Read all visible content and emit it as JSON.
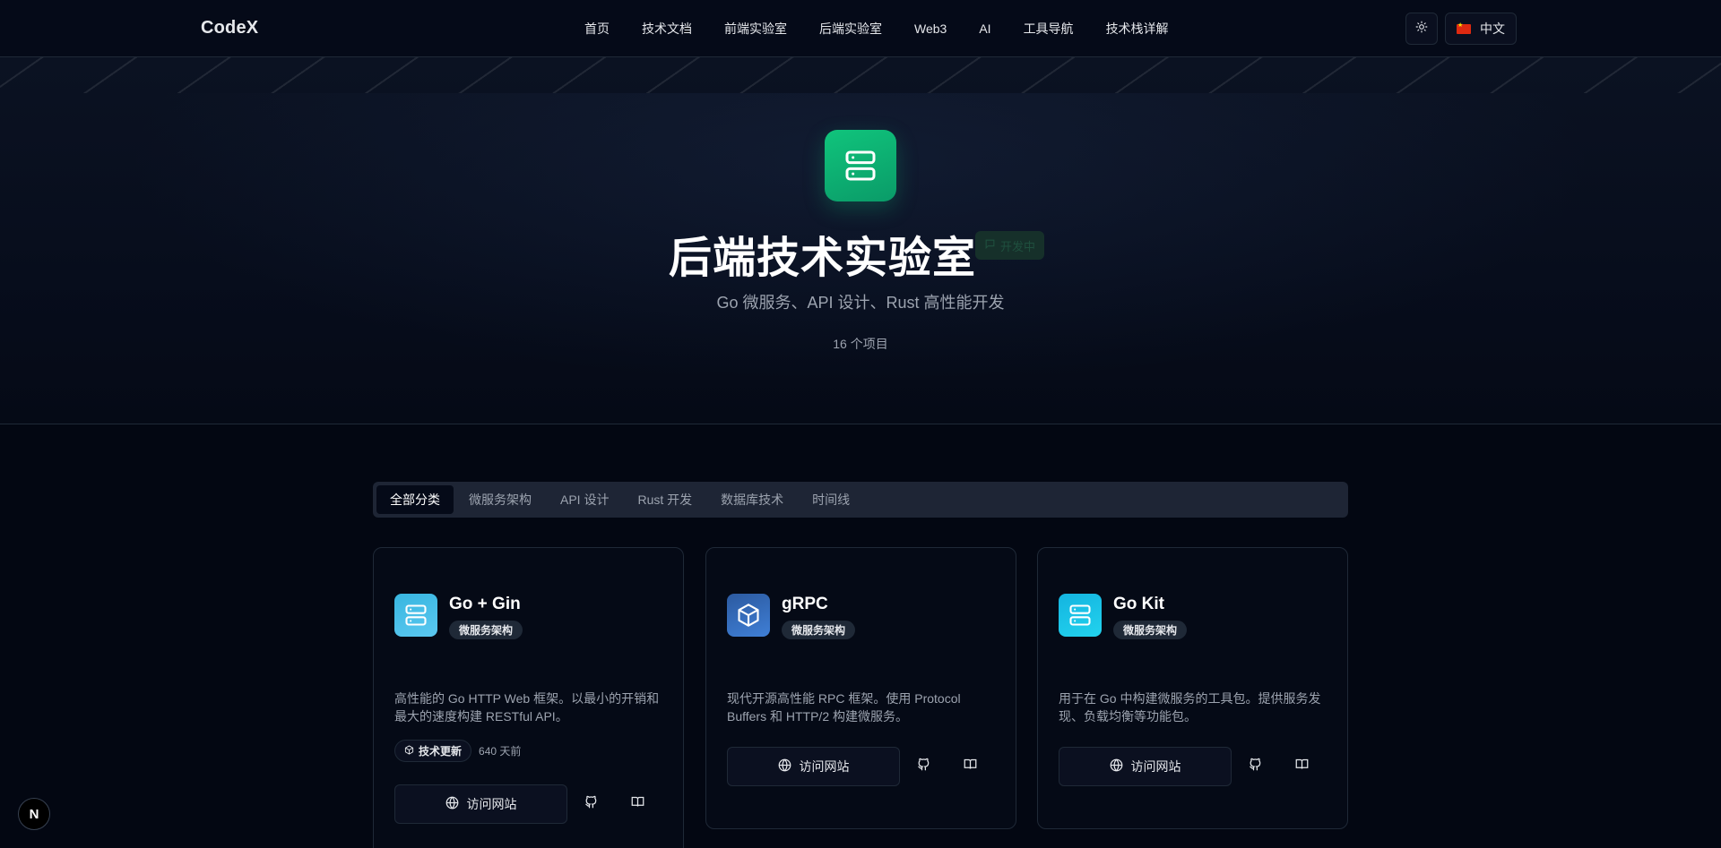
{
  "nav": {
    "logo": "CodeX",
    "links": [
      "首页",
      "技术文档",
      "前端实验室",
      "后端实验室",
      "Web3",
      "AI",
      "工具导航",
      "技术栈详解"
    ],
    "theme_icon": "sun-icon",
    "language": "中文"
  },
  "hero": {
    "icon": "server-icon",
    "title": "后端技术实验室",
    "badge": "开发中",
    "subtitle": "Go 微服务、API 设计、Rust 高性能开发",
    "count": "16 个项目"
  },
  "tabs": {
    "items": [
      "全部分类",
      "微服务架构",
      "API 设计",
      "Rust 开发",
      "数据库技术",
      "时间线"
    ],
    "active_index": 0
  },
  "cards": [
    {
      "icon": "server-icon",
      "icon_gradient": [
        "#38b6e0",
        "#5bc8f0"
      ],
      "title": "Go + Gin",
      "tag": "微服务架构",
      "desc": "高性能的 Go HTTP Web 框架。以最小的开销和最大的速度构建 RESTful API。",
      "meta_chip": "技术更新",
      "meta_text": "640 天前",
      "visit": "访问网站"
    },
    {
      "icon": "box-icon",
      "icon_gradient": [
        "#2c5aa0",
        "#3f7fd6"
      ],
      "title": "gRPC",
      "tag": "微服务架构",
      "desc": "现代开源高性能 RPC 框架。使用 Protocol Buffers 和 HTTP/2 构建微服务。",
      "visit": "访问网站"
    },
    {
      "icon": "server-icon",
      "icon_gradient": [
        "#14b4e0",
        "#22d3ee"
      ],
      "title": "Go Kit",
      "tag": "微服务架构",
      "desc": "用于在 Go 中构建微服务的工具包。提供服务发现、负载均衡等功能包。",
      "visit": "访问网站"
    }
  ],
  "fab": "N"
}
